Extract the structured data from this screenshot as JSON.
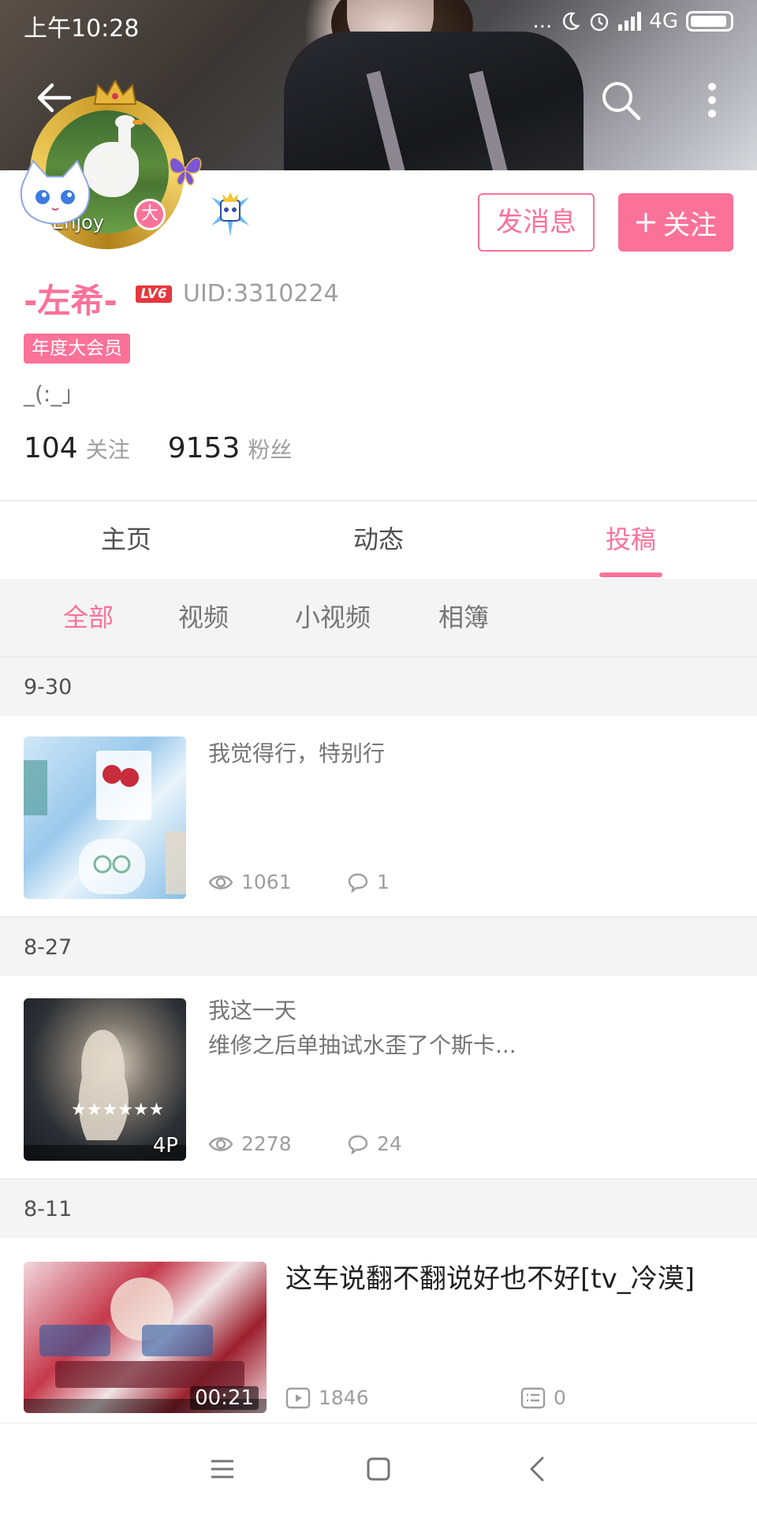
{
  "status_bar": {
    "time": "上午10:28",
    "dots": "...",
    "network": "4G"
  },
  "profile": {
    "avatar_text": "Enjoy",
    "avatar_badge": "大",
    "name": "-左希-",
    "level": "LV6",
    "uid": "UID:3310224",
    "vip_label": "年度大会员",
    "signature": "_(:_」",
    "following_count": "104",
    "following_label": "关注",
    "followers_count": "9153",
    "followers_label": "粉丝"
  },
  "actions": {
    "message": "发消息",
    "follow": "关注",
    "follow_icon": "plus-icon"
  },
  "tabs": [
    {
      "label": "主页",
      "active": false
    },
    {
      "label": "动态",
      "active": false
    },
    {
      "label": "投稿",
      "active": true
    }
  ],
  "subtabs": [
    {
      "label": "全部",
      "active": true
    },
    {
      "label": "视频",
      "active": false
    },
    {
      "label": "小视频",
      "active": false
    },
    {
      "label": "相簿",
      "active": false
    }
  ],
  "groups": [
    {
      "date": "9-30",
      "item": {
        "title": "我觉得行，特别行",
        "subtitle": "",
        "views": "1061",
        "comments": "1",
        "tag": "",
        "view_icon": "eye-icon",
        "comment_icon": "comment-icon"
      }
    },
    {
      "date": "8-27",
      "item": {
        "title": "我这一天",
        "subtitle": "维修之后单抽试水歪了个斯卡...",
        "views": "2278",
        "comments": "24",
        "tag": "4P",
        "view_icon": "eye-icon",
        "comment_icon": "comment-icon"
      }
    },
    {
      "date": "8-11",
      "item": {
        "title": "这车说翻不翻说好也不好[tv_冷漠]",
        "subtitle": "",
        "views": "1846",
        "comments": "0",
        "tag": "00:21",
        "view_icon": "play-icon",
        "comment_icon": "danmaku-icon"
      }
    }
  ],
  "colors": {
    "accent": "#fb7299",
    "text": "#212121",
    "muted": "#9e9e9e",
    "bg_gray": "#f4f4f4"
  }
}
